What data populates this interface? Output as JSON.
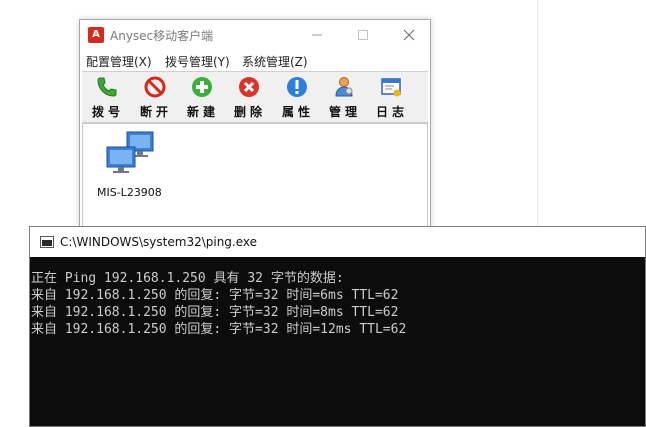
{
  "anysec": {
    "title": "Anysec移动客户端",
    "app_icon_text": "A",
    "menu": [
      {
        "label": "配置管理(X)"
      },
      {
        "label": "拨号管理(Y)"
      },
      {
        "label": "系统管理(Z)"
      }
    ],
    "toolbar": [
      {
        "label": "拨号",
        "icon": "phone-icon"
      },
      {
        "label": "断开",
        "icon": "disconnect-icon"
      },
      {
        "label": "新建",
        "icon": "add-icon"
      },
      {
        "label": "删除",
        "icon": "delete-icon"
      },
      {
        "label": "属性",
        "icon": "info-icon"
      },
      {
        "label": "管理",
        "icon": "user-manage-icon"
      },
      {
        "label": "日志",
        "icon": "log-icon"
      }
    ],
    "hosts": [
      {
        "label": "MIS-L23908",
        "icon": "network-computers-icon"
      }
    ],
    "colors": {
      "accent": "#d52b1e"
    }
  },
  "console": {
    "title": "C:\\WINDOWS\\system32\\ping.exe",
    "lines": [
      "正在 Ping 192.168.1.250 具有 32 字节的数据:",
      "来自 192.168.1.250 的回复: 字节=32 时间=6ms TTL=62",
      "来自 192.168.1.250 的回复: 字节=32 时间=8ms TTL=62",
      "来自 192.168.1.250 的回复: 字节=32 时间=12ms TTL=62"
    ],
    "colors": {
      "background": "#0c0c0c",
      "text": "#cccccc"
    }
  }
}
